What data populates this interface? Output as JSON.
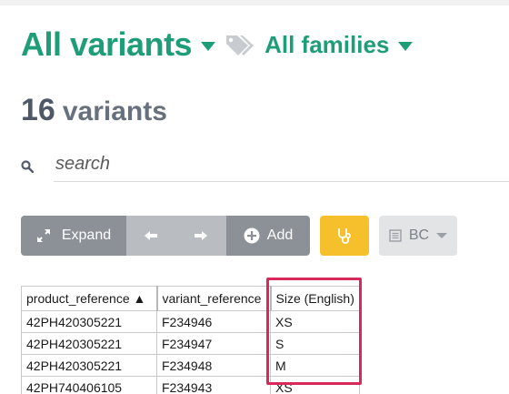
{
  "header": {
    "title": "All variants",
    "families_label": "All families"
  },
  "summary": {
    "count": "16",
    "word": "variants"
  },
  "search": {
    "placeholder": "search"
  },
  "toolbar": {
    "expand_label": "Expand",
    "add_label": "Add",
    "bc_label": "BC"
  },
  "table": {
    "columns": [
      "product_reference ▲",
      "variant_reference",
      "Size (English)"
    ],
    "rows": [
      [
        "42PH420305221",
        "F234946",
        "XS"
      ],
      [
        "42PH420305221",
        "F234947",
        "S"
      ],
      [
        "42PH420305221",
        "F234948",
        "M"
      ],
      [
        "42PH740406105",
        "F234943",
        "XS"
      ]
    ]
  },
  "colors": {
    "accent": "#1d9d78",
    "highlight": "#d8285c",
    "warning_button": "#f5c02c"
  }
}
